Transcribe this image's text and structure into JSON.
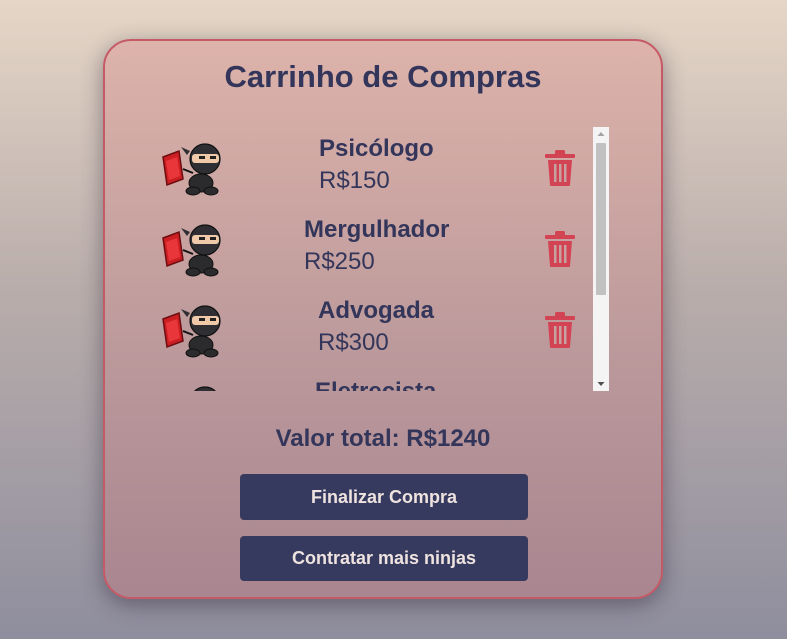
{
  "cart": {
    "title": "Carrinho de Compras",
    "items": [
      {
        "name": "Psicólogo",
        "price": "R$150"
      },
      {
        "name": "Mergulhador",
        "price": "R$250"
      },
      {
        "name": "Advogada",
        "price": "R$300"
      },
      {
        "name": "Eletrecista",
        "price": ""
      }
    ],
    "total": "Valor total: R$1240",
    "finalize_label": "Finalizar Compra",
    "hire_more_label": "Contratar mais ninjas"
  },
  "colors": {
    "title_text": "#33365a",
    "button_bg": "#363a5e",
    "button_text": "#efe3e0",
    "trash_icon": "#d24454",
    "card_border": "#c45a66"
  },
  "icons": {
    "item_image": "ninja-icon",
    "remove": "trash-icon"
  }
}
